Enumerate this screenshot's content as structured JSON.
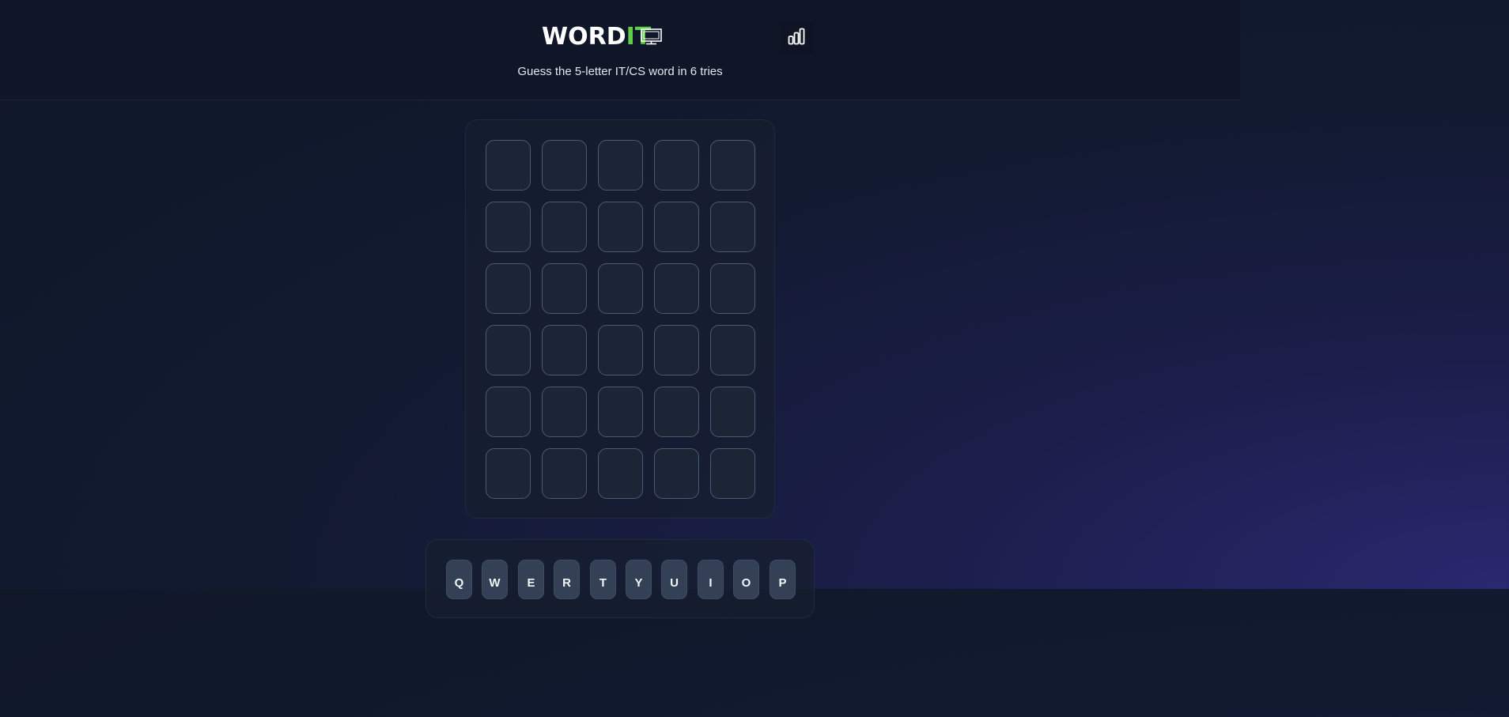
{
  "header": {
    "logo": {
      "word": "WORD",
      "it": "IT"
    },
    "subtitle": "Guess the 5-letter IT/CS word in 6 tries",
    "stats_icon": "bar-chart-icon",
    "monitor_icon": "monitor-icon"
  },
  "colors": {
    "accent": "#5fcf4a",
    "tile_border": "#4b5a70",
    "tile_bg": "#1b2536",
    "key_bg": "#334055"
  },
  "board": {
    "rows": [
      [
        "",
        "",
        "",
        "",
        ""
      ],
      [
        "",
        "",
        "",
        "",
        ""
      ],
      [
        "",
        "",
        "",
        "",
        ""
      ],
      [
        "",
        "",
        "",
        "",
        ""
      ],
      [
        "",
        "",
        "",
        "",
        ""
      ],
      [
        "",
        "",
        "",
        "",
        ""
      ]
    ]
  },
  "keyboard": {
    "row1": [
      "Q",
      "W",
      "E",
      "R",
      "T",
      "Y",
      "U",
      "I",
      "O",
      "P"
    ]
  }
}
